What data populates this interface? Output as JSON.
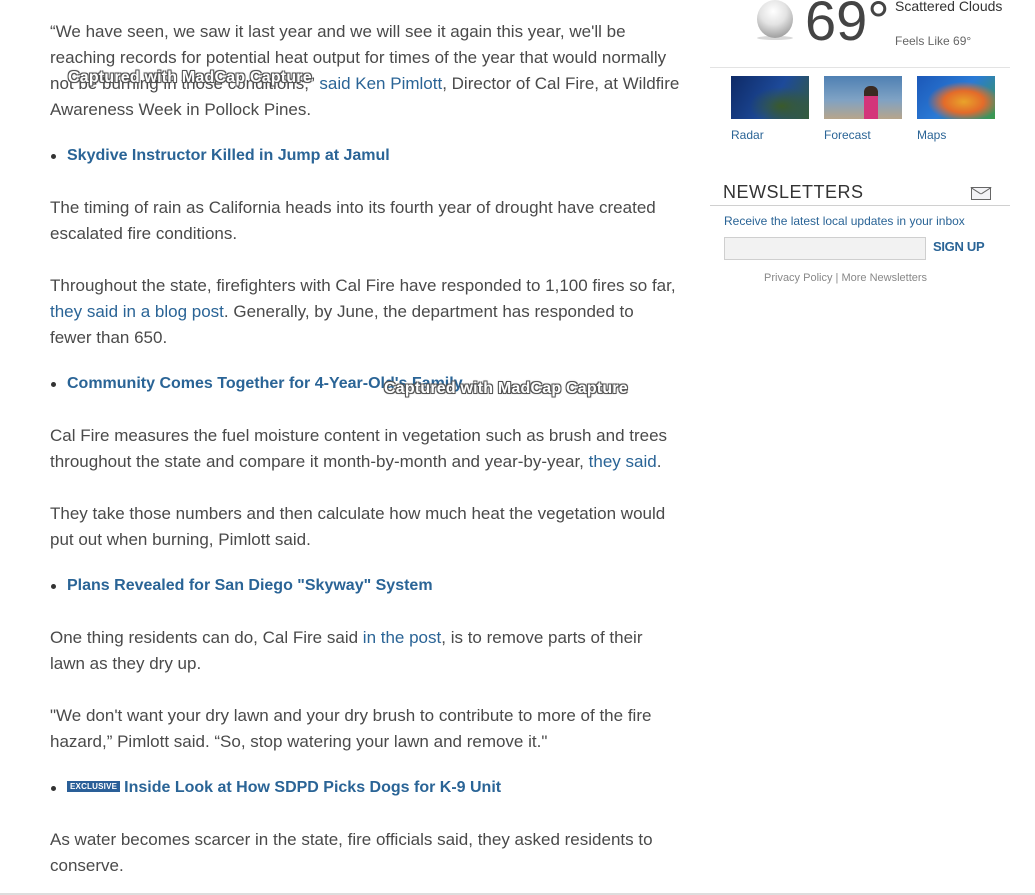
{
  "article": {
    "para_quote_a": "“We have seen, we saw it last year and we will see it again this year, we'll be reaching records for potential heat output for times of the year that would normally not be burning in those conditions,”",
    "para_quote_link": "said Ken Pimlott",
    "para_quote_b": ", Director of Cal Fire, at Wildfire Awareness Week in Pollock Pines.",
    "related_1": "Skydive Instructor Killed in Jump at Jamul",
    "para_timing": "The timing of rain as California heads into its fourth year of drought have created escalated fire conditions.",
    "para_fires_a": "Throughout the state, firefighters with Cal Fire have responded to 1,100 fires so far,",
    "para_fires_link": "they said in a blog post",
    "para_fires_b": ". Generally, by June, the department has responded to fewer than 650.",
    "related_2": "Community Comes Together for 4-Year-Old's Family",
    "para_moisture_a": "Cal Fire measures the fuel moisture content in vegetation such as brush and trees throughout the state and compare it month-by-month and year-by-year,",
    "para_moisture_link": "they said",
    "para_moisture_b": ".",
    "para_heat": "They take those numbers and then calculate how much heat the vegetation would put out when burning, Pimlott said.",
    "related_3": "Plans Revealed for San Diego \"Skyway\" System",
    "para_lawn_a": "One thing residents can do, Cal Fire said",
    "para_lawn_link": "in the post",
    "para_lawn_b": ", is to remove parts of their lawn as they dry up.",
    "para_brush": "\"We don't want your dry lawn and your dry brush to contribute to more of the fire hazard,” Pimlott said. “So, stop watering your lawn and remove it.\"",
    "related_4_badge": "EXCLUSIVE",
    "related_4": "Inside Look at How SDPD Picks Dogs for K-9 Unit",
    "para_conserve": "As water becomes scarcer in the state, fire officials said, they asked residents to conserve."
  },
  "watermark": {
    "text": "Captured with MadCap Capture"
  },
  "weather": {
    "icon": "cloudy-moon-icon",
    "temperature": "69°",
    "condition": "Scattered Clouds",
    "feels_like": "Feels Like 69°",
    "tiles": [
      {
        "label": "Radar"
      },
      {
        "label": "Forecast"
      },
      {
        "label": "Maps"
      }
    ]
  },
  "newsletters": {
    "title": "NEWSLETTERS",
    "icon": "envelope-icon",
    "description": "Receive the latest local updates in your inbox",
    "email_value": "",
    "email_placeholder": "",
    "signup_label": "SIGN UP",
    "privacy_label": "Privacy Policy",
    "separator": "|",
    "more_label": "More Newsletters"
  },
  "colors": {
    "link": "#2a6496",
    "body_text": "#4a4a4a",
    "badge_bg": "#2a5f98"
  }
}
